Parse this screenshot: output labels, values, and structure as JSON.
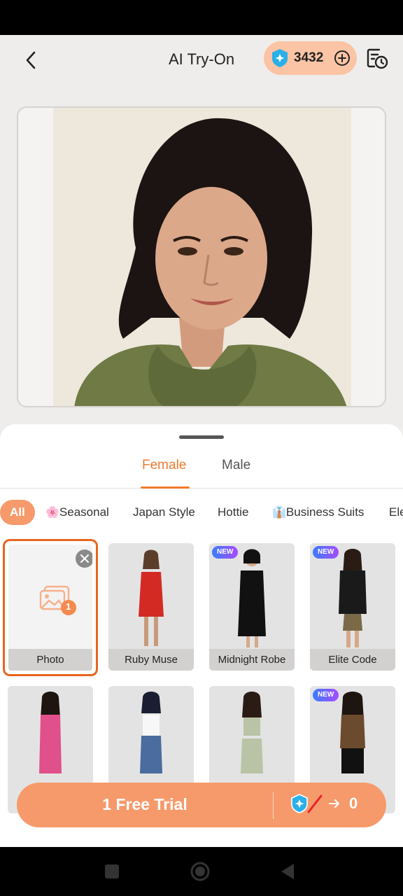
{
  "header": {
    "title": "AI Try-On",
    "coins": "3432"
  },
  "gender_tabs": [
    {
      "label": "Female",
      "active": true
    },
    {
      "label": "Male",
      "active": false
    }
  ],
  "categories": [
    {
      "label": "All",
      "icon": "",
      "active": true
    },
    {
      "label": "Seasonal",
      "icon": "🌸"
    },
    {
      "label": "Japan Style",
      "icon": ""
    },
    {
      "label": "Hottie",
      "icon": ""
    },
    {
      "label": "Business Suits",
      "icon": "👔"
    },
    {
      "label": "Ele",
      "icon": ""
    }
  ],
  "styles": [
    {
      "label": "Photo",
      "type": "upload",
      "badge": "1"
    },
    {
      "label": "Ruby Muse",
      "new": false,
      "color": "#d42a24"
    },
    {
      "label": "Midnight Robe",
      "new": true,
      "badge": "NEW",
      "color": "#111111"
    },
    {
      "label": "Elite Code",
      "new": true,
      "badge": "NEW",
      "color": "#1a1a1a"
    },
    {
      "label": "",
      "new": false,
      "color": "#e0508a"
    },
    {
      "label": "",
      "new": false,
      "color": "#f2f2f2"
    },
    {
      "label": "",
      "new": false,
      "color": "#b9c4a6"
    },
    {
      "label": "",
      "new": true,
      "badge": "NEW",
      "color": "#6b4a2e"
    }
  ],
  "cta": {
    "label": "1 Free Trial",
    "cost": "0"
  },
  "colors": {
    "accent": "#f07a2f",
    "pill": "#fbc4a4",
    "cta": "#f69a6b"
  }
}
